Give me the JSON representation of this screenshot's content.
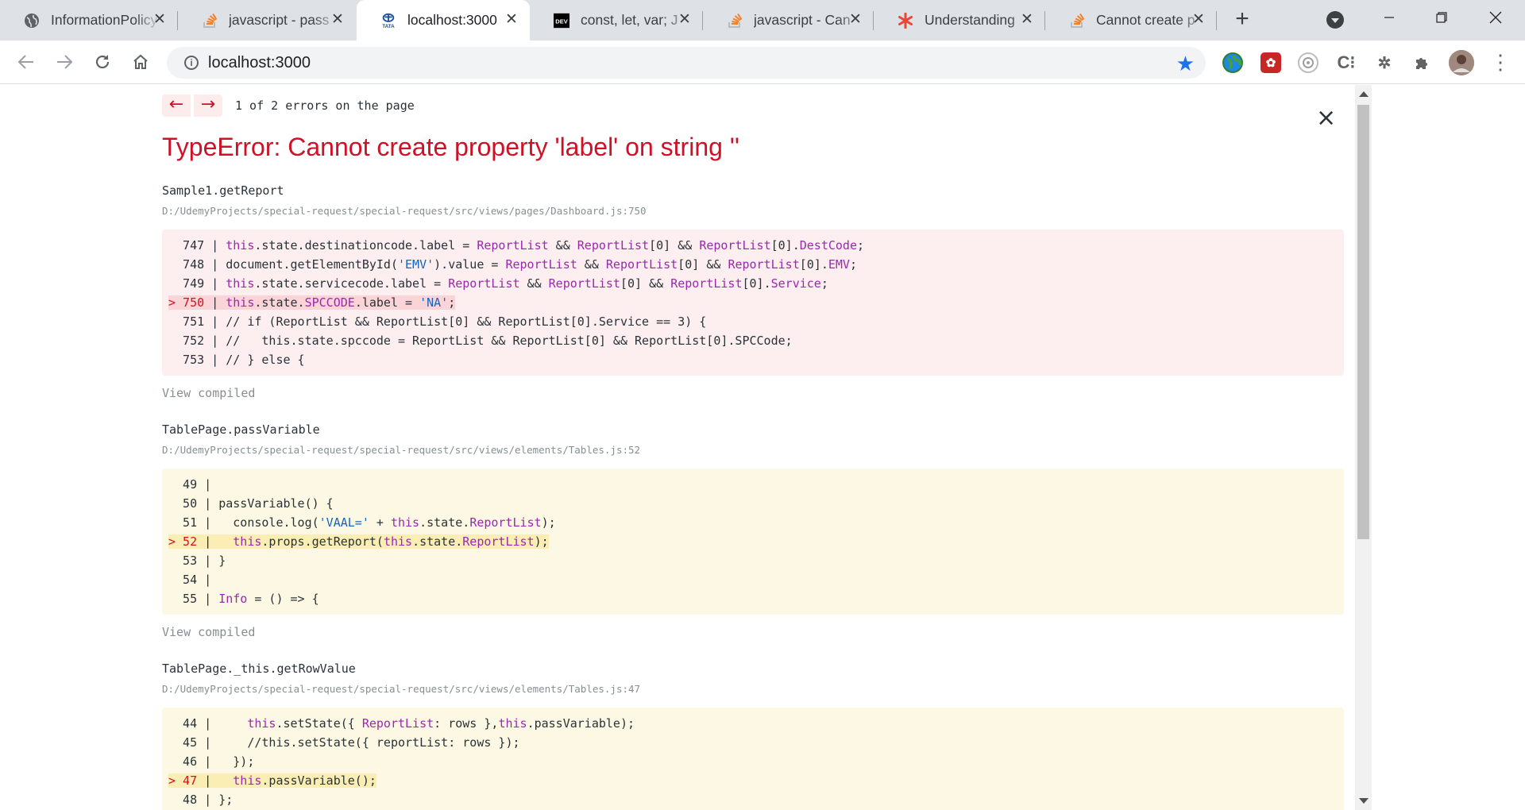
{
  "tabs": [
    {
      "title": "InformationPolicy",
      "icon": "globe-icon",
      "active": false
    },
    {
      "title": "javascript - pass",
      "icon": "stackoverflow-icon",
      "active": false
    },
    {
      "title": "localhost:3000",
      "icon": "tata-icon",
      "active": true
    },
    {
      "title": "const, let, var; J",
      "icon": "dev-icon",
      "active": false
    },
    {
      "title": "javascript - Can",
      "icon": "stackoverflow-icon",
      "active": false
    },
    {
      "title": "Understanding",
      "icon": "asterisk-icon",
      "active": false
    },
    {
      "title": "Cannot create p",
      "icon": "stackoverflow-icon",
      "active": false
    }
  ],
  "address_bar": {
    "url": "localhost:3000"
  },
  "error_overlay": {
    "nav_prev": "←",
    "nav_next": "→",
    "error_count": "1 of 2 errors on the page",
    "close": "×",
    "title": "TypeError: Cannot create property 'label' on string ''",
    "frames": [
      {
        "name": "Sample1.getReport",
        "path": "D:/UdemyProjects/special-request/special-request/src/views/pages/Dashboard.js:750",
        "view_compiled": "View compiled",
        "lines": [
          {
            "num": "  747",
            "code": "this.state.destinationcode.label = ReportList && ReportList[0] && ReportList[0].DestCode;"
          },
          {
            "num": "  748",
            "code": "document.getElementById('EMV').value = ReportList && ReportList[0] && ReportList[0].EMV;"
          },
          {
            "num": "  749",
            "code": "this.state.servicecode.label = ReportList && ReportList[0] && ReportList[0].Service;"
          },
          {
            "num": "> 750",
            "code": "this.state.SPCCODE.label = 'NA';",
            "highlight": true
          },
          {
            "num": "  751",
            "code": "// if (ReportList && ReportList[0] && ReportList[0].Service == 3) {"
          },
          {
            "num": "  752",
            "code": "//   this.state.spccode = ReportList && ReportList[0] && ReportList[0].SPCCode;"
          },
          {
            "num": "  753",
            "code": "// } else {"
          }
        ]
      },
      {
        "name": "TablePage.passVariable",
        "path": "D:/UdemyProjects/special-request/special-request/src/views/elements/Tables.js:52",
        "view_compiled": "View compiled",
        "lines": [
          {
            "num": "  49",
            "code": ""
          },
          {
            "num": "  50",
            "code": "passVariable() {"
          },
          {
            "num": "  51",
            "code": "  console.log('VAAL=' + this.state.ReportList);"
          },
          {
            "num": "> 52",
            "code": "  this.props.getReport(this.state.ReportList);",
            "highlight": true
          },
          {
            "num": "  53",
            "code": "}"
          },
          {
            "num": "  54",
            "code": ""
          },
          {
            "num": "  55",
            "code": "Info = () => {"
          }
        ]
      },
      {
        "name": "TablePage._this.getRowValue",
        "path": "D:/UdemyProjects/special-request/special-request/src/views/elements/Tables.js:47",
        "lines": [
          {
            "num": "  44",
            "code": "    this.setState({ ReportList: rows },this.passVariable);"
          },
          {
            "num": "  45",
            "code": "    //this.setState({ reportList: rows });"
          },
          {
            "num": "  46",
            "code": "  });"
          },
          {
            "num": "> 47",
            "code": "  this.passVariable();",
            "highlight": true
          },
          {
            "num": "  48",
            "code": "};"
          }
        ]
      }
    ]
  },
  "colors": {
    "error_red": "#ce1126",
    "red_box": "#fdeef0",
    "yellow_box": "#fcf8e3",
    "keyword": "#9c27b0",
    "string": "#1565c0",
    "star": "#1a73e8"
  }
}
